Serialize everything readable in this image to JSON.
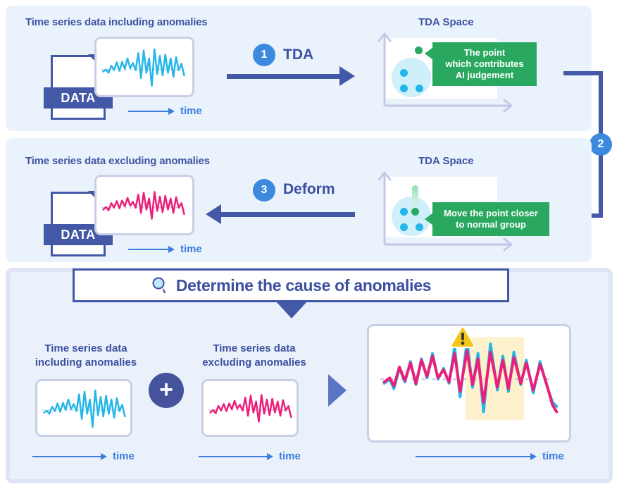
{
  "diagram": {
    "title": "TDA anomaly analysis workflow",
    "colors": {
      "panel_bg": "#eaf2fc",
      "bottom_panel_border": "#dfe4f4",
      "heading_text": "#4154a3",
      "arrow_navy": "#4458a8",
      "badge_blue": "#3c8ade",
      "callout_green": "#2aa860",
      "series_anomaly": "#23b6e8",
      "series_normal": "#ec1e79",
      "highlight_band": "#fdf2cd",
      "warning_yellow": "#f5c518",
      "time_axis_blue": "#3a7ddc",
      "plus_circle": "#44539c",
      "play_triangle": "#5b74c4"
    }
  },
  "row1": {
    "heading": "Time series data including anomalies",
    "file_label": "DATA",
    "time_label": "time",
    "step": {
      "number": "1",
      "label": "TDA"
    },
    "tda_title": "TDA Space",
    "callout": "The point\nwhich contributes\nAI judgement",
    "callout_lines": [
      "The point",
      "which contributes",
      "AI judgement"
    ]
  },
  "row2": {
    "heading": "Time series data excluding anomalies",
    "file_label": "DATA",
    "time_label": "time",
    "step": {
      "number": "3",
      "label": "Deform"
    },
    "tda_title": "TDA Space",
    "callout_lines": [
      "Move the point closer",
      "to normal group"
    ]
  },
  "connector": {
    "step": {
      "number": "2",
      "label": ""
    }
  },
  "banner": {
    "icon": "magnifier-icon",
    "text": "Determine the cause of anomalies"
  },
  "bottom": {
    "left_card": {
      "label_lines": [
        "Time series data",
        "including anomalies"
      ],
      "time_label": "time"
    },
    "operator": "+",
    "right_card": {
      "label_lines": [
        "Time series data",
        "excluding anomalies"
      ],
      "time_label": "time"
    },
    "result_card": {
      "time_label": "time",
      "warning_icon": "warning-triangle-icon"
    }
  },
  "chart_data": [
    {
      "type": "line",
      "name": "row1-including-anomalies",
      "title": "Time series data including anomalies",
      "xlabel": "time",
      "ylabel": "",
      "series": [
        {
          "name": "including anomalies",
          "color": "#23b6e8",
          "values": [
            0,
            0.05,
            -0.12,
            0.2,
            0.05,
            0.3,
            0.02,
            0.34,
            0.1,
            0.45,
            0.12,
            0.3,
            0.05,
            0.62,
            -0.28,
            0.75,
            -0.1,
            0.5,
            -0.75,
            0.8,
            -0.2,
            0.55,
            -0.18,
            0.6,
            -0.3
          ]
        }
      ],
      "baseline": 0,
      "grid": false
    },
    {
      "type": "line",
      "name": "row2-excluding-anomalies",
      "title": "Time series data excluding anomalies",
      "xlabel": "time",
      "ylabel": "",
      "series": [
        {
          "name": "excluding anomalies",
          "color": "#ec1e79",
          "values": [
            0,
            0.08,
            -0.06,
            0.22,
            0.06,
            0.3,
            0.08,
            0.33,
            0.12,
            0.42,
            0.14,
            0.28,
            0.1,
            0.5,
            -0.16,
            0.58,
            -0.06,
            0.44,
            -0.4,
            0.6,
            -0.12,
            0.48,
            -0.12,
            0.5,
            -0.35
          ]
        }
      ],
      "baseline": 0,
      "grid": false
    },
    {
      "type": "line",
      "name": "bottom-combined-overlay",
      "title": "Combined comparison",
      "xlabel": "time",
      "ylabel": "",
      "annotations": [
        {
          "type": "highlight-band",
          "x_start": 0.48,
          "x_end": 0.78,
          "color": "#fdf2cd"
        },
        {
          "type": "warning-marker",
          "x": 0.5,
          "icon": "warning-triangle-icon"
        }
      ],
      "series": [
        {
          "name": "including anomalies",
          "color": "#23b6e8",
          "values": [
            0,
            0.05,
            -0.12,
            0.2,
            0.05,
            0.3,
            0.02,
            0.34,
            0.1,
            0.45,
            0.12,
            0.3,
            0.05,
            0.62,
            -0.28,
            0.75,
            -0.1,
            0.5,
            -0.75,
            0.8,
            -0.2,
            0.55,
            -0.18,
            0.6,
            -0.3
          ]
        },
        {
          "name": "excluding anomalies",
          "color": "#ec1e79",
          "values": [
            0,
            0.08,
            -0.06,
            0.22,
            0.06,
            0.3,
            0.08,
            0.33,
            0.12,
            0.42,
            0.14,
            0.28,
            0.1,
            0.5,
            -0.16,
            0.58,
            -0.06,
            0.44,
            -0.4,
            0.6,
            -0.12,
            0.48,
            -0.12,
            0.5,
            -0.35
          ]
        }
      ],
      "baseline": 0,
      "grid": false
    }
  ]
}
